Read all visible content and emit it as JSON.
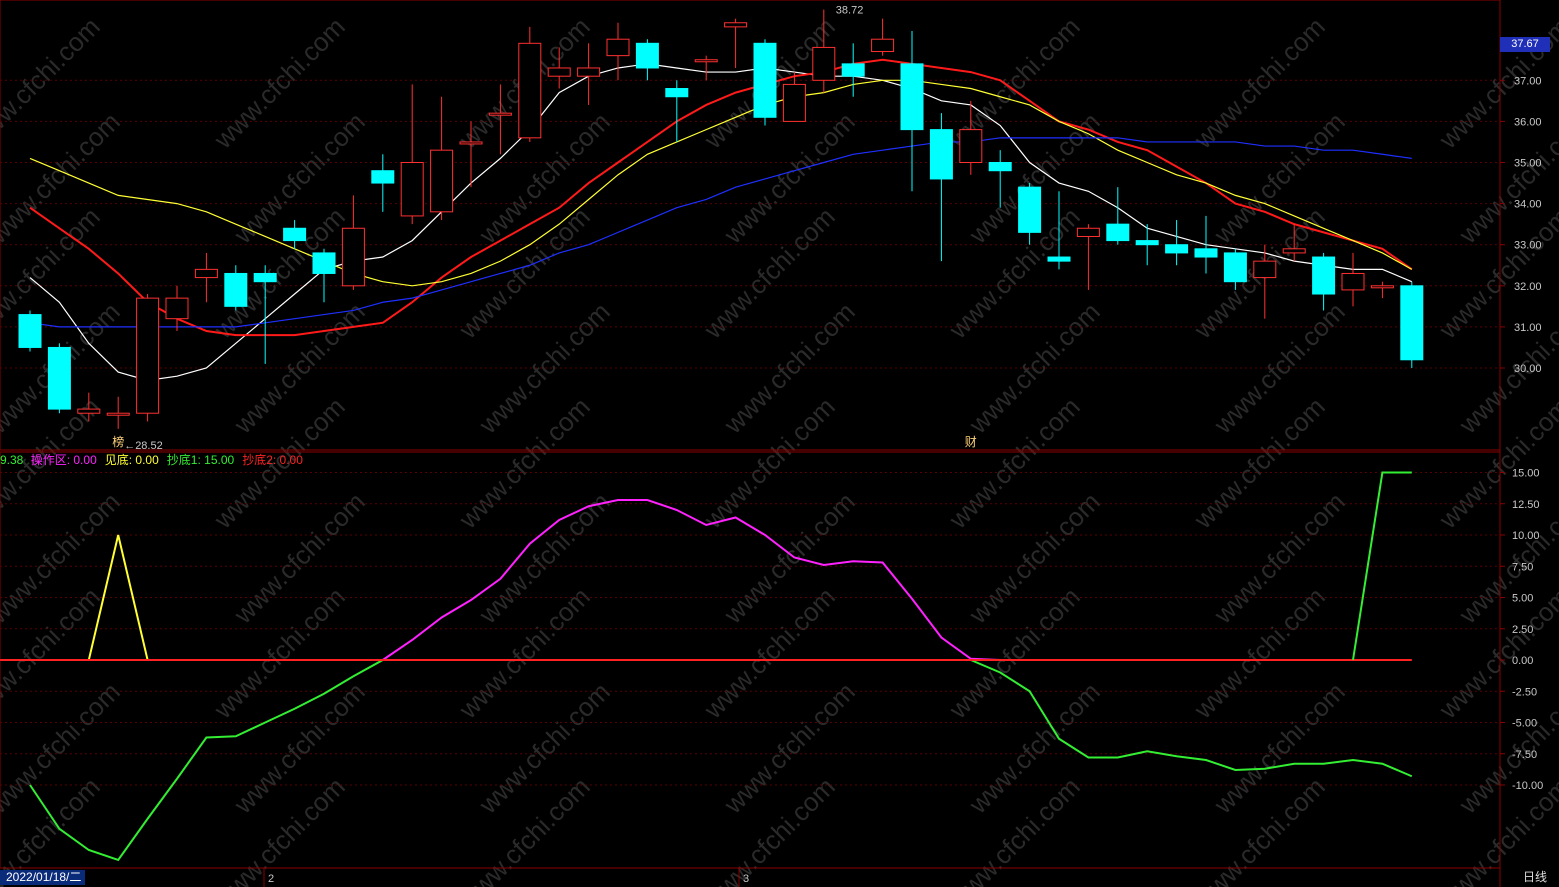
{
  "chart_data": [
    {
      "type": "candlestick",
      "title": "",
      "y_axis_side": "right",
      "ylim": [
        28.52,
        38.72
      ],
      "y_ticks": [
        "30.00",
        "31.00",
        "32.00",
        "33.00",
        "34.00",
        "35.00",
        "36.00",
        "37.00"
      ],
      "last_price": "37.67",
      "extreme_high_label": "38.72",
      "extreme_low_label": "28.52",
      "candles": [
        {
          "o": 31.3,
          "c": 30.5,
          "h": 31.4,
          "l": 30.4
        },
        {
          "o": 30.5,
          "c": 29.0,
          "h": 30.6,
          "l": 28.9
        },
        {
          "o": 28.9,
          "c": 29.0,
          "h": 29.4,
          "l": 28.7
        },
        {
          "o": 28.9,
          "c": 28.9,
          "h": 29.3,
          "l": 28.52
        },
        {
          "o": 28.9,
          "c": 31.7,
          "h": 31.8,
          "l": 28.7
        },
        {
          "o": 31.2,
          "c": 31.7,
          "h": 32.0,
          "l": 30.9
        },
        {
          "o": 32.2,
          "c": 32.4,
          "h": 32.8,
          "l": 31.6
        },
        {
          "o": 32.3,
          "c": 31.5,
          "h": 32.5,
          "l": 31.4
        },
        {
          "o": 32.3,
          "c": 32.1,
          "h": 32.5,
          "l": 30.1
        },
        {
          "o": 33.4,
          "c": 33.1,
          "h": 33.6,
          "l": 32.9
        },
        {
          "o": 32.8,
          "c": 32.3,
          "h": 32.9,
          "l": 31.6
        },
        {
          "o": 32.0,
          "c": 33.4,
          "h": 34.2,
          "l": 31.9
        },
        {
          "o": 34.8,
          "c": 34.5,
          "h": 35.2,
          "l": 33.8
        },
        {
          "o": 33.7,
          "c": 35.0,
          "h": 36.9,
          "l": 33.5
        },
        {
          "o": 33.8,
          "c": 35.3,
          "h": 36.6,
          "l": 33.6
        },
        {
          "o": 35.5,
          "c": 35.5,
          "h": 36.0,
          "l": 34.4
        },
        {
          "o": 36.2,
          "c": 36.2,
          "h": 36.9,
          "l": 35.2
        },
        {
          "o": 35.6,
          "c": 37.9,
          "h": 38.3,
          "l": 35.5
        },
        {
          "o": 37.1,
          "c": 37.3,
          "h": 37.8,
          "l": 36.8
        },
        {
          "o": 37.1,
          "c": 37.3,
          "h": 37.9,
          "l": 36.4
        },
        {
          "o": 37.6,
          "c": 38.0,
          "h": 38.4,
          "l": 37.0
        },
        {
          "o": 37.9,
          "c": 37.3,
          "h": 38.0,
          "l": 37.0
        },
        {
          "o": 36.8,
          "c": 36.6,
          "h": 37.0,
          "l": 35.5
        },
        {
          "o": 37.5,
          "c": 37.5,
          "h": 37.6,
          "l": 37.0
        },
        {
          "o": 38.3,
          "c": 38.4,
          "h": 38.5,
          "l": 37.3
        },
        {
          "o": 37.9,
          "c": 36.1,
          "h": 38.0,
          "l": 35.9
        },
        {
          "o": 36.0,
          "c": 36.9,
          "h": 37.2,
          "l": 36.1
        },
        {
          "o": 37.0,
          "c": 37.8,
          "h": 38.72,
          "l": 36.7
        },
        {
          "o": 37.4,
          "c": 37.1,
          "h": 37.9,
          "l": 36.6
        },
        {
          "o": 37.7,
          "c": 38.0,
          "h": 38.5,
          "l": 37.6
        },
        {
          "o": 37.4,
          "c": 35.8,
          "h": 38.2,
          "l": 34.3
        },
        {
          "o": 35.8,
          "c": 34.6,
          "h": 36.2,
          "l": 32.6
        },
        {
          "o": 35.0,
          "c": 35.8,
          "h": 36.5,
          "l": 34.7
        },
        {
          "o": 35.0,
          "c": 34.8,
          "h": 35.3,
          "l": 33.9
        },
        {
          "o": 34.4,
          "c": 33.3,
          "h": 34.5,
          "l": 33.0
        },
        {
          "o": 32.7,
          "c": 32.6,
          "h": 34.3,
          "l": 32.4
        },
        {
          "o": 33.2,
          "c": 33.4,
          "h": 33.5,
          "l": 31.9
        },
        {
          "o": 33.5,
          "c": 33.1,
          "h": 34.4,
          "l": 33.0
        },
        {
          "o": 33.1,
          "c": 33.0,
          "h": 33.5,
          "l": 32.5
        },
        {
          "o": 33.0,
          "c": 32.8,
          "h": 33.6,
          "l": 32.5
        },
        {
          "o": 32.9,
          "c": 32.7,
          "h": 33.7,
          "l": 32.3
        },
        {
          "o": 32.8,
          "c": 32.1,
          "h": 32.9,
          "l": 31.9
        },
        {
          "o": 32.2,
          "c": 32.6,
          "h": 33.0,
          "l": 31.2
        },
        {
          "o": 32.8,
          "c": 32.9,
          "h": 33.5,
          "l": 32.6
        },
        {
          "o": 32.7,
          "c": 31.8,
          "h": 32.8,
          "l": 31.4
        },
        {
          "o": 31.9,
          "c": 32.3,
          "h": 32.8,
          "l": 31.5
        },
        {
          "o": 32.0,
          "c": 32.0,
          "h": 32.1,
          "l": 31.7
        },
        {
          "o": 32.0,
          "c": 30.2,
          "h": 32.1,
          "l": 30.0
        }
      ],
      "ma_series": [
        {
          "color": "#ffffff",
          "values": [
            32.2,
            31.6,
            30.6,
            29.9,
            29.7,
            29.8,
            30.0,
            30.6,
            31.2,
            31.8,
            32.4,
            32.6,
            32.7,
            33.1,
            33.8,
            34.5,
            35.1,
            35.8,
            36.7,
            37.1,
            37.3,
            37.4,
            37.3,
            37.2,
            37.2,
            37.3,
            37.2,
            37.1,
            37.1,
            37.0,
            36.8,
            36.5,
            36.4,
            35.9,
            35.0,
            34.5,
            34.3,
            33.9,
            33.4,
            33.2,
            33.0,
            32.9,
            32.8,
            32.6,
            32.5,
            32.4,
            32.4,
            32.1
          ]
        },
        {
          "color": "#ff1a1a",
          "values": [
            33.9,
            33.4,
            32.9,
            32.3,
            31.6,
            31.2,
            30.9,
            30.8,
            30.8,
            30.8,
            30.9,
            31.0,
            31.1,
            31.6,
            32.2,
            32.7,
            33.1,
            33.5,
            33.9,
            34.5,
            35.0,
            35.5,
            36.0,
            36.4,
            36.7,
            36.9,
            37.1,
            37.2,
            37.4,
            37.5,
            37.4,
            37.3,
            37.2,
            37.0,
            36.5,
            36.0,
            35.8,
            35.5,
            35.3,
            34.9,
            34.5,
            34.0,
            33.8,
            33.5,
            33.3,
            33.1,
            32.9,
            32.4
          ]
        },
        {
          "color": "#ffff33",
          "values": [
            35.1,
            34.8,
            34.5,
            34.2,
            34.1,
            34.0,
            33.8,
            33.5,
            33.2,
            32.9,
            32.6,
            32.3,
            32.1,
            32.0,
            32.1,
            32.3,
            32.6,
            33.0,
            33.5,
            34.1,
            34.7,
            35.2,
            35.5,
            35.8,
            36.1,
            36.4,
            36.6,
            36.7,
            36.9,
            37.0,
            37.0,
            36.9,
            36.8,
            36.6,
            36.4,
            36.0,
            35.7,
            35.3,
            35.0,
            34.7,
            34.5,
            34.2,
            34.0,
            33.7,
            33.4,
            33.1,
            32.8,
            32.4
          ]
        },
        {
          "color": "#1f2fff",
          "values": [
            31.1,
            31.0,
            31.0,
            31.0,
            31.0,
            31.0,
            31.0,
            31.0,
            31.1,
            31.2,
            31.3,
            31.4,
            31.6,
            31.7,
            31.9,
            32.1,
            32.3,
            32.5,
            32.8,
            33.0,
            33.3,
            33.6,
            33.9,
            34.1,
            34.4,
            34.6,
            34.8,
            35.0,
            35.2,
            35.3,
            35.4,
            35.5,
            35.5,
            35.6,
            35.6,
            35.6,
            35.6,
            35.6,
            35.5,
            35.5,
            35.5,
            35.5,
            35.4,
            35.4,
            35.3,
            35.3,
            35.2,
            35.1
          ]
        }
      ],
      "markers": [
        {
          "index": 3,
          "text": "榜"
        },
        {
          "index": 32,
          "text": "财"
        }
      ]
    },
    {
      "type": "line",
      "title": "",
      "y_axis_side": "right",
      "ylim": [
        -16,
        16
      ],
      "y_ticks": [
        "15.00",
        "12.50",
        "10.00",
        "7.50",
        "5.00",
        "2.50",
        "0.00",
        "-2.50",
        "-5.00",
        "-7.50",
        "-10.00"
      ],
      "series": [
        {
          "name": "操作区",
          "color": "#ff22ff",
          "values": [
            0,
            0,
            0,
            0,
            0,
            0,
            0,
            0,
            0,
            0,
            0,
            0,
            0,
            1.6,
            3.4,
            4.8,
            6.5,
            9.3,
            11.2,
            12.3,
            12.8,
            12.8,
            12.0,
            10.8,
            11.4,
            10.0,
            8.2,
            7.6,
            7.9,
            7.8,
            4.9,
            1.8,
            0.1,
            0,
            0,
            0,
            0,
            0,
            0,
            0,
            0,
            0,
            0,
            0,
            0,
            0,
            0,
            0
          ]
        },
        {
          "name": "见底",
          "color": "#ffff33",
          "values": [
            0,
            0,
            0,
            10.0,
            0,
            0,
            0,
            0,
            0,
            0,
            0,
            0,
            0,
            0,
            0,
            0,
            0,
            0,
            0,
            0,
            0,
            0,
            0,
            0,
            0,
            0,
            0,
            0,
            0,
            0,
            0,
            0,
            0,
            0,
            0,
            0,
            0,
            0,
            0,
            0,
            0,
            0,
            0,
            0,
            0,
            0,
            0,
            0
          ]
        },
        {
          "name": "抄底1",
          "color": "#33ee33",
          "values": [
            -10.0,
            -13.5,
            -15.2,
            -16.0,
            -12.7,
            -9.5,
            -6.2,
            -6.1,
            -5.0,
            -3.9,
            -2.7,
            -1.3,
            0.0,
            0,
            0,
            0,
            0,
            0,
            0,
            0,
            0,
            0,
            0,
            0,
            0,
            0,
            0,
            0,
            0,
            0,
            0,
            0,
            0,
            -1.0,
            -2.5,
            -6.3,
            -7.8,
            -7.8,
            -7.3,
            -7.7,
            -8.0,
            -8.8,
            -8.7,
            -8.3,
            -8.3,
            -8.0,
            -8.3,
            -9.3
          ]
        },
        {
          "name": "抄底2",
          "color": "#ff2222",
          "values": [
            0,
            0,
            0,
            0,
            0,
            0,
            0,
            0,
            0,
            0,
            0,
            0,
            0,
            0,
            0,
            0,
            0,
            0,
            0,
            0,
            0,
            0,
            0,
            0,
            0,
            0,
            0,
            0,
            0,
            0,
            0,
            0,
            0,
            0,
            0,
            0,
            0,
            0,
            0,
            0,
            0,
            0,
            0,
            0,
            0,
            0,
            0,
            0
          ]
        },
        {
          "name": "抄底1-high",
          "color": "#33ee33",
          "values": [
            0,
            0,
            0,
            0,
            0,
            0,
            0,
            0,
            0,
            0,
            0,
            0,
            0,
            0,
            0,
            0,
            0,
            0,
            0,
            0,
            0,
            0,
            0,
            0,
            0,
            0,
            0,
            0,
            0,
            0,
            0,
            0,
            0,
            0,
            0,
            0,
            0,
            0,
            0,
            0,
            0,
            0,
            0,
            0,
            0,
            0,
            15.0,
            15.0
          ]
        }
      ]
    }
  ],
  "legend": {
    "first": "9.38",
    "items": [
      {
        "label": "操作区:",
        "value": "0.00",
        "color": "#ff22ff"
      },
      {
        "label": "见底:",
        "value": "0.00",
        "color": "#ffff33"
      },
      {
        "label": "抄底1:",
        "value": "15.00",
        "color": "#33ee33"
      },
      {
        "label": "抄底2:",
        "value": "0.00",
        "color": "#ff2222"
      }
    ]
  },
  "footer": {
    "date": "2022/01/18/二",
    "month_marks": [
      "2",
      "3"
    ],
    "period": "日线"
  },
  "watermark": "www.cfchi.com"
}
